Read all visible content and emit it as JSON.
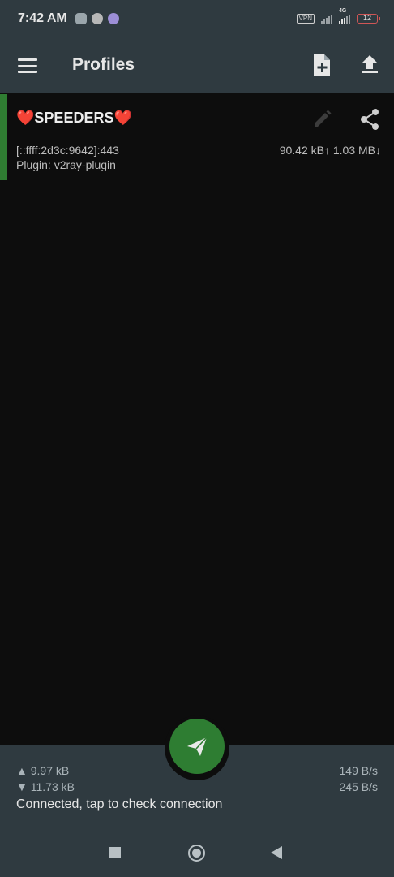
{
  "status_bar": {
    "time": "7:42 AM",
    "vpn_label": "VPN",
    "network_type": "4G",
    "battery": "12"
  },
  "toolbar": {
    "title": "Profiles"
  },
  "profile": {
    "name_prefix": "❤️",
    "name": "SPEEDERS",
    "name_suffix": "❤️",
    "address": "[::ffff:2d3c:9642]:443",
    "plugin": "Plugin: v2ray-plugin",
    "traffic": "90.42 kB↑ 1.03 MB↓"
  },
  "stats": {
    "upload_total": "▲ 9.97 kB",
    "download_total": "▼ 11.73 kB",
    "upload_rate": "149 B/s",
    "download_rate": "245 B/s",
    "status": "Connected, tap to check connection"
  },
  "colors": {
    "accent_green": "#2e7d32",
    "toolbar_bg": "#2f3a40",
    "background": "#0d0d0d"
  }
}
